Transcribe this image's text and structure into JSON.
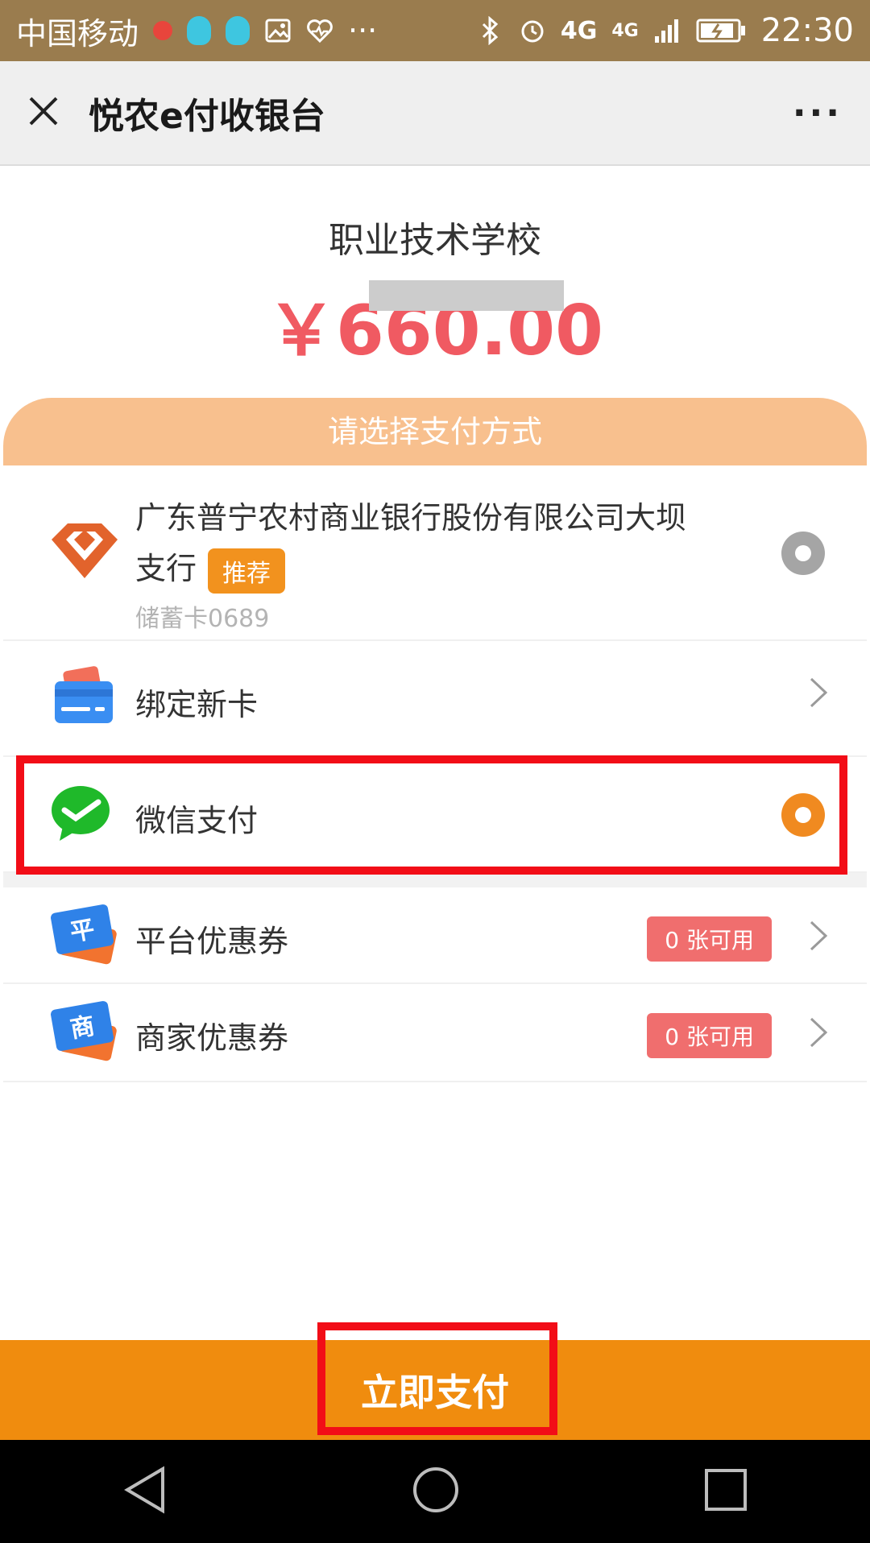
{
  "status_bar": {
    "carrier": "中国移动",
    "network": "4G",
    "network2": "4G",
    "time": "22:30"
  },
  "nav": {
    "title": "悦农e付收银台",
    "more": "···"
  },
  "merchant": {
    "name": "职业技术学校",
    "amount": "￥660.00"
  },
  "section": {
    "title": "请选择支付方式"
  },
  "methods": {
    "bank": {
      "name_line1": "广东普宁农村商业银行股份有限公司大坝",
      "name_line2": "支行",
      "badge": "推荐",
      "card": "储蓄卡0689"
    },
    "new_card": {
      "label": "绑定新卡"
    },
    "wechat": {
      "label": "微信支付"
    },
    "platform_coupon": {
      "label": "平台优惠券",
      "badge": "0 张可用",
      "icon_char": "平"
    },
    "merchant_coupon": {
      "label": "商家优惠券",
      "badge": "0 张可用",
      "icon_char": "商"
    }
  },
  "pay_button": {
    "label": "立即支付"
  },
  "colors": {
    "status_bar": "#9a7c4e",
    "amount": "#f05a62",
    "section_head": "#f8c08e",
    "accent_orange": "#f08c0e",
    "highlight_red": "#f20d17",
    "coupon_badge": "#f06e6e"
  }
}
